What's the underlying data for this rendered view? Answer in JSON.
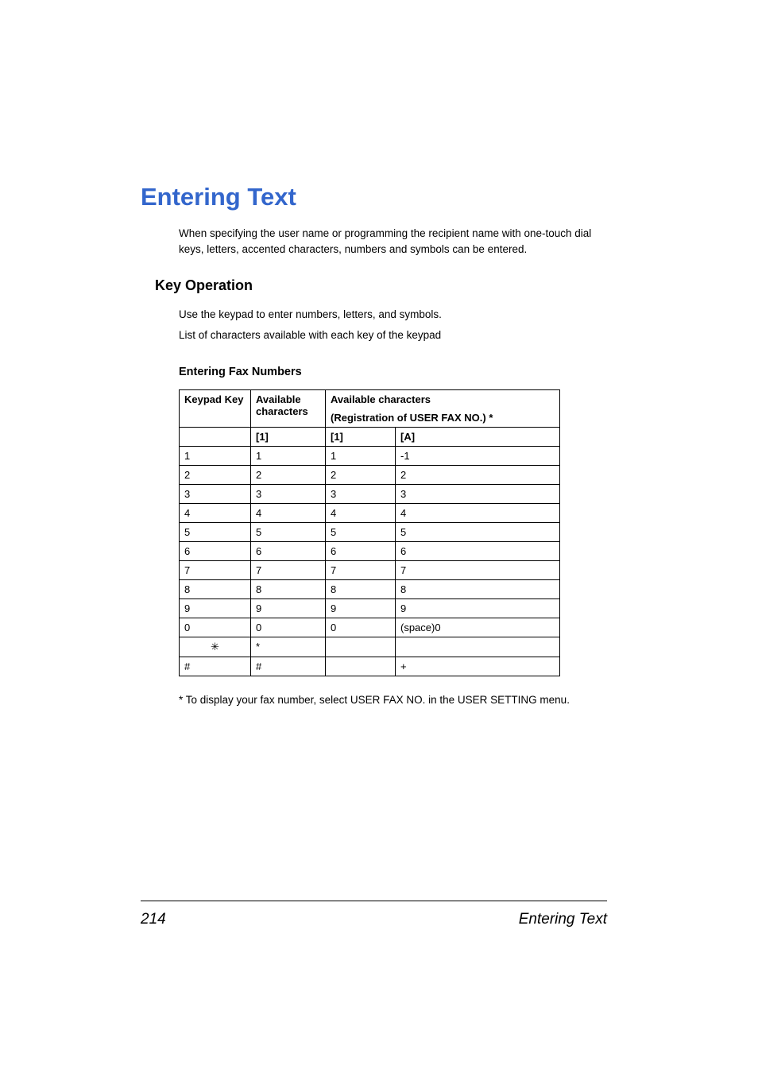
{
  "headings": {
    "main": "Entering Text",
    "sub": "Key Operation",
    "tableTitle": "Entering Fax Numbers"
  },
  "paragraphs": {
    "intro": "When specifying the user name or programming the recipient name with one-touch dial keys, letters, accented characters, numbers and symbols can be entered.",
    "body1": "Use the keypad to enter numbers, letters, and symbols.",
    "body2": "List of characters available with each key of the keypad",
    "footnote": "* To display your fax number, select USER FAX NO. in the USER SETTING menu."
  },
  "table": {
    "headers": {
      "keypadKey": "Keypad Key",
      "availableChars": "Available characters",
      "availableCharsTop": "Available characters",
      "registration": "(Registration of USER FAX NO.) *",
      "col1": "[1]",
      "col2": "[1]",
      "col3": "[A]"
    },
    "rows": [
      {
        "key": "1",
        "a": "1",
        "b": "1",
        "c": "-1"
      },
      {
        "key": "2",
        "a": "2",
        "b": "2",
        "c": "2"
      },
      {
        "key": "3",
        "a": "3",
        "b": "3",
        "c": "3"
      },
      {
        "key": "4",
        "a": "4",
        "b": "4",
        "c": "4"
      },
      {
        "key": "5",
        "a": "5",
        "b": "5",
        "c": "5"
      },
      {
        "key": "6",
        "a": "6",
        "b": "6",
        "c": "6"
      },
      {
        "key": "7",
        "a": "7",
        "b": "7",
        "c": "7"
      },
      {
        "key": "8",
        "a": "8",
        "b": "8",
        "c": "8"
      },
      {
        "key": "9",
        "a": "9",
        "b": "9",
        "c": "9"
      },
      {
        "key": "0",
        "a": "0",
        "b": "0",
        "c": "(space)0"
      },
      {
        "key": "✳",
        "a": "*",
        "b": "",
        "c": ""
      },
      {
        "key": "#",
        "a": "#",
        "b": "",
        "c": "+"
      }
    ]
  },
  "footer": {
    "pageNumber": "214",
    "section": "Entering Text"
  }
}
